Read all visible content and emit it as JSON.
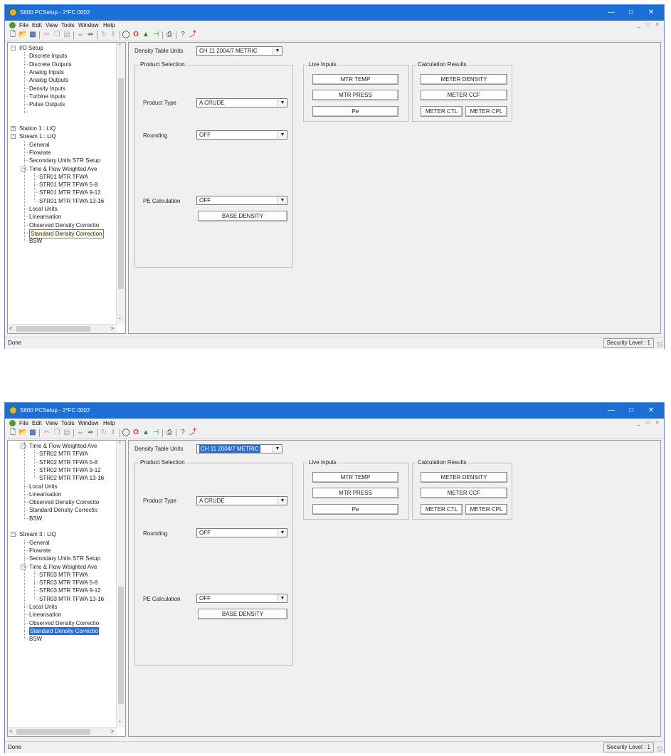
{
  "windows": [
    {
      "title": "S600 PCSetup - 2*FC 0002",
      "menu": [
        "File",
        "Edit",
        "View",
        "Tools",
        "Window",
        "Help"
      ],
      "tree": [
        {
          "label": "I/O Setup",
          "indent": 0,
          "exp": "-"
        },
        {
          "label": "Discrete Inputs",
          "indent": 1
        },
        {
          "label": "Discrete Outputs",
          "indent": 1
        },
        {
          "label": "Analog Inputs",
          "indent": 1
        },
        {
          "label": "Analog Outputs",
          "indent": 1
        },
        {
          "label": "Density Inputs",
          "indent": 1
        },
        {
          "label": "Turbine Inputs",
          "indent": 1
        },
        {
          "label": "Pulse Outputs",
          "indent": 1
        },
        {
          "label": "",
          "indent": 1
        },
        {
          "label": "",
          "indent": 0
        },
        {
          "label": "Station 1 : LIQ",
          "indent": 0,
          "exp": "+"
        },
        {
          "label": "Stream 1 : LIQ",
          "indent": 0,
          "exp": "-"
        },
        {
          "label": "General",
          "indent": 1
        },
        {
          "label": "Flowrate",
          "indent": 1
        },
        {
          "label": "Secondary Units STR Setup",
          "indent": 1
        },
        {
          "label": "Time & Flow Weighted Ave",
          "indent": 1,
          "exp": "-"
        },
        {
          "label": "STR01 MTR TFWA",
          "indent": 2
        },
        {
          "label": "STR01 MTR TFWA 5-8",
          "indent": 2
        },
        {
          "label": "STR01 MTR TFWA 9-12",
          "indent": 2
        },
        {
          "label": "STR01 MTR TFWA 13-16",
          "indent": 2
        },
        {
          "label": "Local Units",
          "indent": 1
        },
        {
          "label": "Linearisation",
          "indent": 1
        },
        {
          "label": "Observed Density Correctio",
          "indent": 1
        },
        {
          "label": "Standard Density Correction",
          "indent": 1,
          "sel": "box"
        },
        {
          "label": "BSW",
          "indent": 1
        }
      ],
      "density_table_units_label": "Density Table Units",
      "density_table_units_value": "CH 11 2004/7 METRIC",
      "product_selection_title": "Product Selection",
      "product_type_label": "Product Type",
      "product_type_value": "A CRUDE",
      "rounding_label": "Rounding",
      "rounding_value": "OFF",
      "pe_calc_label": "PE Calculation",
      "pe_calc_value": "OFF",
      "base_density_btn": "BASE DENSITY",
      "live_inputs_title": "Live Inputs",
      "live_inputs": [
        "MTR TEMP",
        "MTR PRESS",
        "Pe"
      ],
      "calc_results_title": "Calculation Results",
      "meter_density_btn": "METER DENSITY",
      "meter_ccf_btn": "METER CCF",
      "meter_ctl_btn": "METER CTL",
      "meter_cpl_btn": "METER CPL",
      "status_left": "Done",
      "status_right": "Security Level : 1"
    },
    {
      "title": "S600 PCSetup - 2*FC 0002",
      "menu": [
        "File",
        "Edit",
        "View",
        "Tools",
        "Window",
        "Help"
      ],
      "tree": [
        {
          "label": "Time & Flow Weighted Ave",
          "indent": 1,
          "exp": "-"
        },
        {
          "label": "STR02 MTR TFWA",
          "indent": 2
        },
        {
          "label": "STR02 MTR TFWA 5-8",
          "indent": 2
        },
        {
          "label": "STR02 MTR TFWA 9-12",
          "indent": 2
        },
        {
          "label": "STR02 MTR TFWA 13-16",
          "indent": 2
        },
        {
          "label": "Local Units",
          "indent": 1
        },
        {
          "label": "Linearisation",
          "indent": 1
        },
        {
          "label": "Observed Density Correctio",
          "indent": 1
        },
        {
          "label": "Standard Density Correctio",
          "indent": 1
        },
        {
          "label": "BSW",
          "indent": 1
        },
        {
          "label": "",
          "indent": 0
        },
        {
          "label": "Stream 3 : LIQ",
          "indent": 0,
          "exp": "-"
        },
        {
          "label": "General",
          "indent": 1
        },
        {
          "label": "Flowrate",
          "indent": 1
        },
        {
          "label": "Secondary Units STR Setup",
          "indent": 1
        },
        {
          "label": "Time & Flow Weighted Ave",
          "indent": 1,
          "exp": "-"
        },
        {
          "label": "STR03 MTR TFWA",
          "indent": 2
        },
        {
          "label": "STR03 MTR TFWA 5-8",
          "indent": 2
        },
        {
          "label": "STR03 MTR TFWA 9-12",
          "indent": 2
        },
        {
          "label": "STR03 MTR TFWA 13-16",
          "indent": 2
        },
        {
          "label": "Local Units",
          "indent": 1
        },
        {
          "label": "Linearisation",
          "indent": 1
        },
        {
          "label": "Observed Density Correctio",
          "indent": 1
        },
        {
          "label": "Standard Density Correctio",
          "indent": 1,
          "sel": "blue"
        },
        {
          "label": "BSW",
          "indent": 1
        }
      ],
      "density_table_units_label": "Density Table Units",
      "density_table_units_value": "CH 11 2004/7 METRIC",
      "product_selection_title": "Product Selection",
      "product_type_label": "Product Type",
      "product_type_value": "A CRUDE",
      "rounding_label": "Rounding",
      "rounding_value": "OFF",
      "pe_calc_label": "PE Calculation",
      "pe_calc_value": "OFF",
      "base_density_btn": "BASE DENSITY",
      "live_inputs_title": "Live Inputs",
      "live_inputs": [
        "MTR TEMP",
        "MTR PRESS",
        "Pe"
      ],
      "calc_results_title": "Calculation Results",
      "meter_density_btn": "METER DENSITY",
      "meter_ccf_btn": "METER CCF",
      "meter_ctl_btn": "METER CTL",
      "meter_cpl_btn": "METER CPL",
      "status_left": "Done",
      "status_right": "Security Level : 1"
    }
  ],
  "icons": [
    "app-icon",
    "new-icon",
    "open-icon",
    "save-icon",
    "cut-icon",
    "copy-icon",
    "paste-icon",
    "connect-icon",
    "disconnect-icon",
    "refresh-icon",
    "stop-icon",
    "run-icon",
    "transfer-icon",
    "print-icon",
    "help-icon",
    "arrow-icon"
  ],
  "colors": {
    "titlebar": "#1c6fd6",
    "selection": "#2a6dd6"
  }
}
